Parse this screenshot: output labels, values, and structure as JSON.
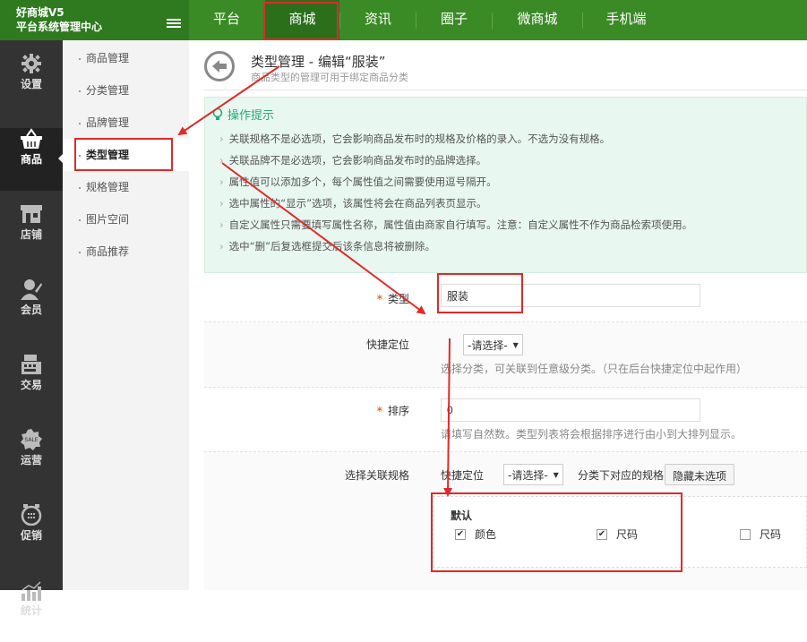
{
  "brand": {
    "line1": "好商城V5",
    "line2": "平台系统管理中心"
  },
  "topnav": {
    "tabs": [
      "平台",
      "商城",
      "资讯",
      "圈子",
      "微商城",
      "手机端"
    ],
    "active_index": 1
  },
  "sidebar": {
    "items": [
      {
        "label": "设置",
        "icon": "gear-icon"
      },
      {
        "label": "商品",
        "icon": "basket-icon"
      },
      {
        "label": "店铺",
        "icon": "shop-icon"
      },
      {
        "label": "会员",
        "icon": "user-icon"
      },
      {
        "label": "交易",
        "icon": "register-icon"
      },
      {
        "label": "运营",
        "icon": "sale-badge-icon"
      },
      {
        "label": "促销",
        "icon": "alarm-clock-icon"
      },
      {
        "label": "统计",
        "icon": "bar-chart-icon"
      }
    ],
    "active_index": 1
  },
  "submenu": {
    "items": [
      "商品管理",
      "分类管理",
      "品牌管理",
      "类型管理",
      "规格管理",
      "图片空间",
      "商品推荐"
    ],
    "active_index": 3
  },
  "header": {
    "title": "类型管理 - 编辑“服装”",
    "subtitle": "商品类型的管理可用于绑定商品分类"
  },
  "tips": {
    "title": "操作提示",
    "items": [
      "关联规格不是必选项，它会影响商品发布时的规格及价格的录入。不选为没有规格。",
      "关联品牌不是必选项，它会影响商品发布时的品牌选择。",
      "属性值可以添加多个，每个属性值之间需要使用逗号隔开。",
      "选中属性的“显示”选项，该属性将会在商品列表页显示。",
      "自定义属性只需要填写属性名称，属性值由商家自行填写。注意：自定义属性不作为商品检索项使用。",
      "选中“删”后复选框提交后该条信息将被删除。"
    ]
  },
  "form": {
    "type": {
      "label": "类型",
      "value": "服装"
    },
    "quick_locate": {
      "label": "快捷定位",
      "select": "-请选择-",
      "hint": "选择分类，可关联到任意级分类。（只在后台快捷定位中起作用）"
    },
    "sort": {
      "label": "排序",
      "value": "0",
      "hint": "请填写自然数。类型列表将会根据排序进行由小到大排列显示。"
    },
    "spec": {
      "label": "选择关联规格",
      "quick_label": "快捷定位",
      "select": "-请选择-",
      "after_select": "分类下对应的规格",
      "hide_button": "隐藏未选项",
      "group_title": "默认",
      "options": [
        {
          "label": "颜色",
          "checked": true
        },
        {
          "label": "尺码",
          "checked": true
        },
        {
          "label": "尺码",
          "checked": false
        }
      ]
    }
  },
  "colors": {
    "nav_green": "#3a8a26",
    "accent_teal": "#27a87f",
    "highlight_red": "#e02a2a",
    "sidebar_dark": "#333333"
  }
}
